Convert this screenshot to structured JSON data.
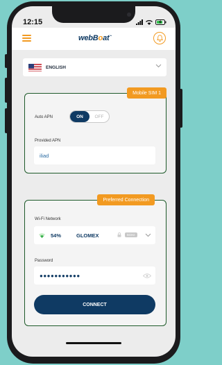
{
  "status_bar": {
    "time": "12:15"
  },
  "header": {
    "logo_pre": "web",
    "logo_o": "o",
    "logo_post": "at"
  },
  "language": {
    "selected": "ENGLISH"
  },
  "sim_card": {
    "badge": "Mobile SIM 1",
    "auto_apn_label": "Auto APN",
    "toggle_on": "ON",
    "toggle_off": "OFF",
    "toggle_state": "on",
    "provided_apn_label": "Provided APN",
    "provided_apn_value": "iliad"
  },
  "connection_card": {
    "badge": "Preferred Connection",
    "wifi_label": "Wi-Fi Network",
    "signal_percent": "54%",
    "ssid": "GLOMEX",
    "band": "5GHz",
    "password_label": "Password",
    "password_mask": "●●●●●●●●●●●",
    "connect_label": "CONNECT"
  },
  "colors": {
    "accent": "#f29a21",
    "primary": "#0f3a63",
    "card_border": "#1e5a2a",
    "background": "#7ecfc9"
  }
}
